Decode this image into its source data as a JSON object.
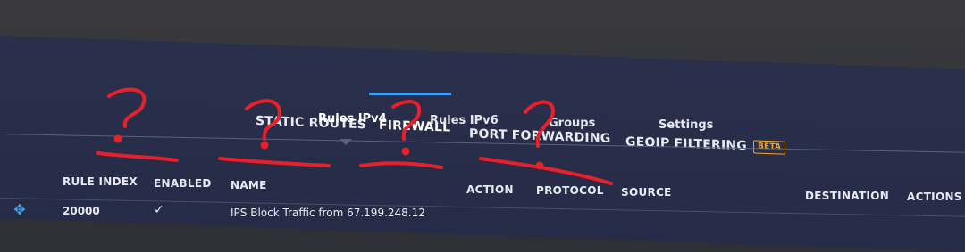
{
  "main_tabs": [
    {
      "label": "STATIC ROUTES"
    },
    {
      "label": "FIREWALL",
      "active": true
    },
    {
      "label": "PORT FORWARDING"
    },
    {
      "label": "GEOIP FILTERING",
      "badge": "BETA"
    }
  ],
  "sub_tabs": [
    {
      "label": "Rules IPv4",
      "active": true
    },
    {
      "label": "Rules IPv6"
    },
    {
      "label": "Groups"
    },
    {
      "label": "Settings"
    }
  ],
  "table": {
    "columns": [
      "RULE INDEX",
      "ENABLED",
      "NAME",
      "ACTION",
      "PROTOCOL",
      "SOURCE",
      "DESTINATION",
      "ACTIONS"
    ],
    "rows": [
      {
        "rule_index": "20000",
        "enabled": "✓",
        "name": "IPS Block Traffic from 67.199.248.12"
      }
    ]
  },
  "annotations": {
    "color": "#e8202a",
    "marks": [
      "?",
      "?",
      "?",
      "?"
    ]
  },
  "colors": {
    "accent": "#3ea0f0",
    "beta": "#f5a623",
    "screen_bg": "#2a2f4c"
  },
  "icons": {
    "drag_handle": "move-icon",
    "enabled": "checkmark-icon",
    "active_subtab_pointer": "caret-down-icon"
  }
}
